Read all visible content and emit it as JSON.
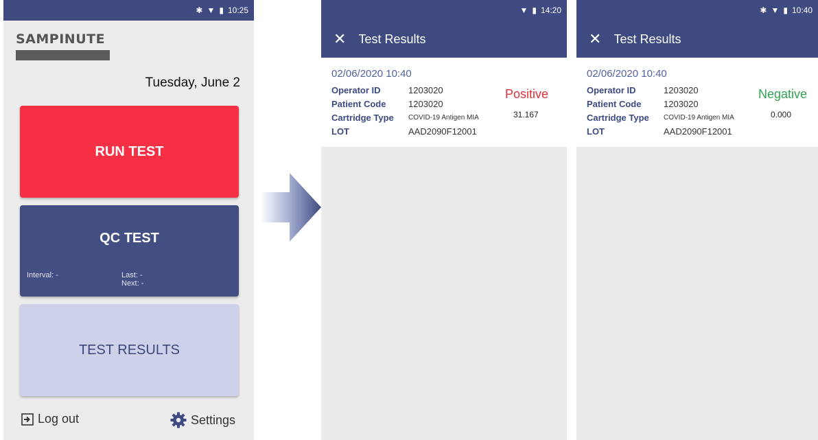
{
  "home": {
    "status_time": "10:25",
    "brand": "SAMPINUTE",
    "date": "Tuesday, June 2",
    "run_test": "RUN TEST",
    "qc_test": "QC TEST",
    "qc_interval": "Interval: -",
    "qc_last": "Last: -",
    "qc_next": "Next: -",
    "test_results": "TEST RESULTS",
    "logout": "Log out",
    "settings": "Settings",
    "colors": {
      "run_test": "#f52f44",
      "qc_test": "#434e83",
      "test_results": "#cdd2ea",
      "header": "#3f4a80"
    }
  },
  "result_positive": {
    "status_time": "14:20",
    "title": "Test Results",
    "date": "02/06/2020 10:40",
    "operator_label": "Operator ID",
    "operator_value": "1203020",
    "patient_label": "Patient Code",
    "patient_value": "1203020",
    "cartridge_label": "Cartridge Type",
    "cartridge_value": "COVID-19 Antigen MIA",
    "lot_label": "LOT",
    "lot_value": "AAD2090F12001",
    "result": "Positive",
    "result_value": "31.167",
    "result_color": "#e0303c"
  },
  "result_negative": {
    "status_time": "10:40",
    "title": "Test Results",
    "date": "02/06/2020 10:40",
    "operator_label": "Operator ID",
    "operator_value": "1203020",
    "patient_label": "Patient Code",
    "patient_value": "1203020",
    "cartridge_label": "Cartridge Type",
    "cartridge_value": "COVID-19 Antigen MIA",
    "lot_label": "LOT",
    "lot_value": "AAD2090F12001",
    "result": "Negative",
    "result_value": "0.000",
    "result_color": "#2fa34f"
  }
}
